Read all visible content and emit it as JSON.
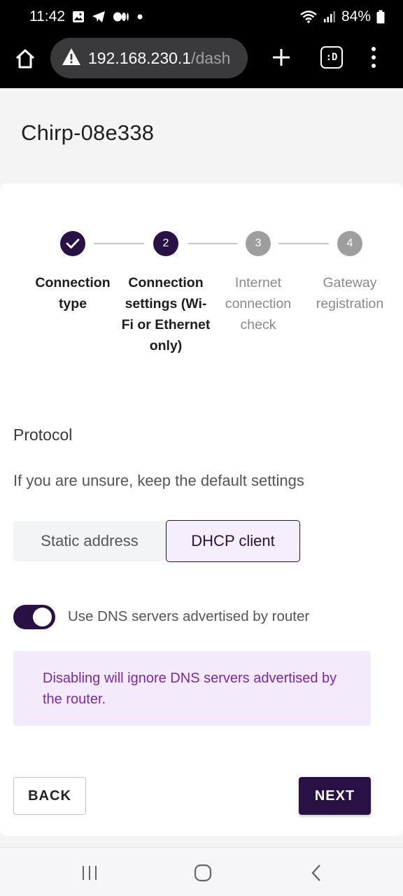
{
  "status_bar": {
    "time": "11:42",
    "battery_percent": "84%",
    "left_icons": [
      "gallery-icon",
      "telegram-icon",
      "medium-icon",
      "dot-icon"
    ],
    "right_icons": [
      "wifi-icon",
      "signal-icon",
      "battery-icon"
    ]
  },
  "browser": {
    "url_host": "192.168.230.1",
    "url_path": "/dash",
    "tabs_label": ":D"
  },
  "page": {
    "title": "Chirp-08e338"
  },
  "stepper": {
    "steps": [
      {
        "number": "1",
        "label": "Connection type",
        "state": "done"
      },
      {
        "number": "2",
        "label": "Connection settings (Wi-Fi or Ethernet only)",
        "state": "active"
      },
      {
        "number": "3",
        "label": "Internet connection check",
        "state": "pending"
      },
      {
        "number": "4",
        "label": "Gateway registration",
        "state": "pending"
      }
    ]
  },
  "protocol": {
    "section_title": "Protocol",
    "hint": "If you are unsure, keep the default settings",
    "options": [
      "Static address",
      "DHCP client"
    ],
    "selected": "DHCP client"
  },
  "dns": {
    "toggle_label": "Use DNS servers advertised by router",
    "enabled": true,
    "info": "Disabling will ignore DNS servers advertised by the router."
  },
  "actions": {
    "back_label": "BACK",
    "next_label": "NEXT"
  },
  "colors": {
    "primary": "#2a1145",
    "info_bg": "#f3eafb",
    "info_text": "#7a2aa6",
    "inactive": "#9e9e9e"
  }
}
